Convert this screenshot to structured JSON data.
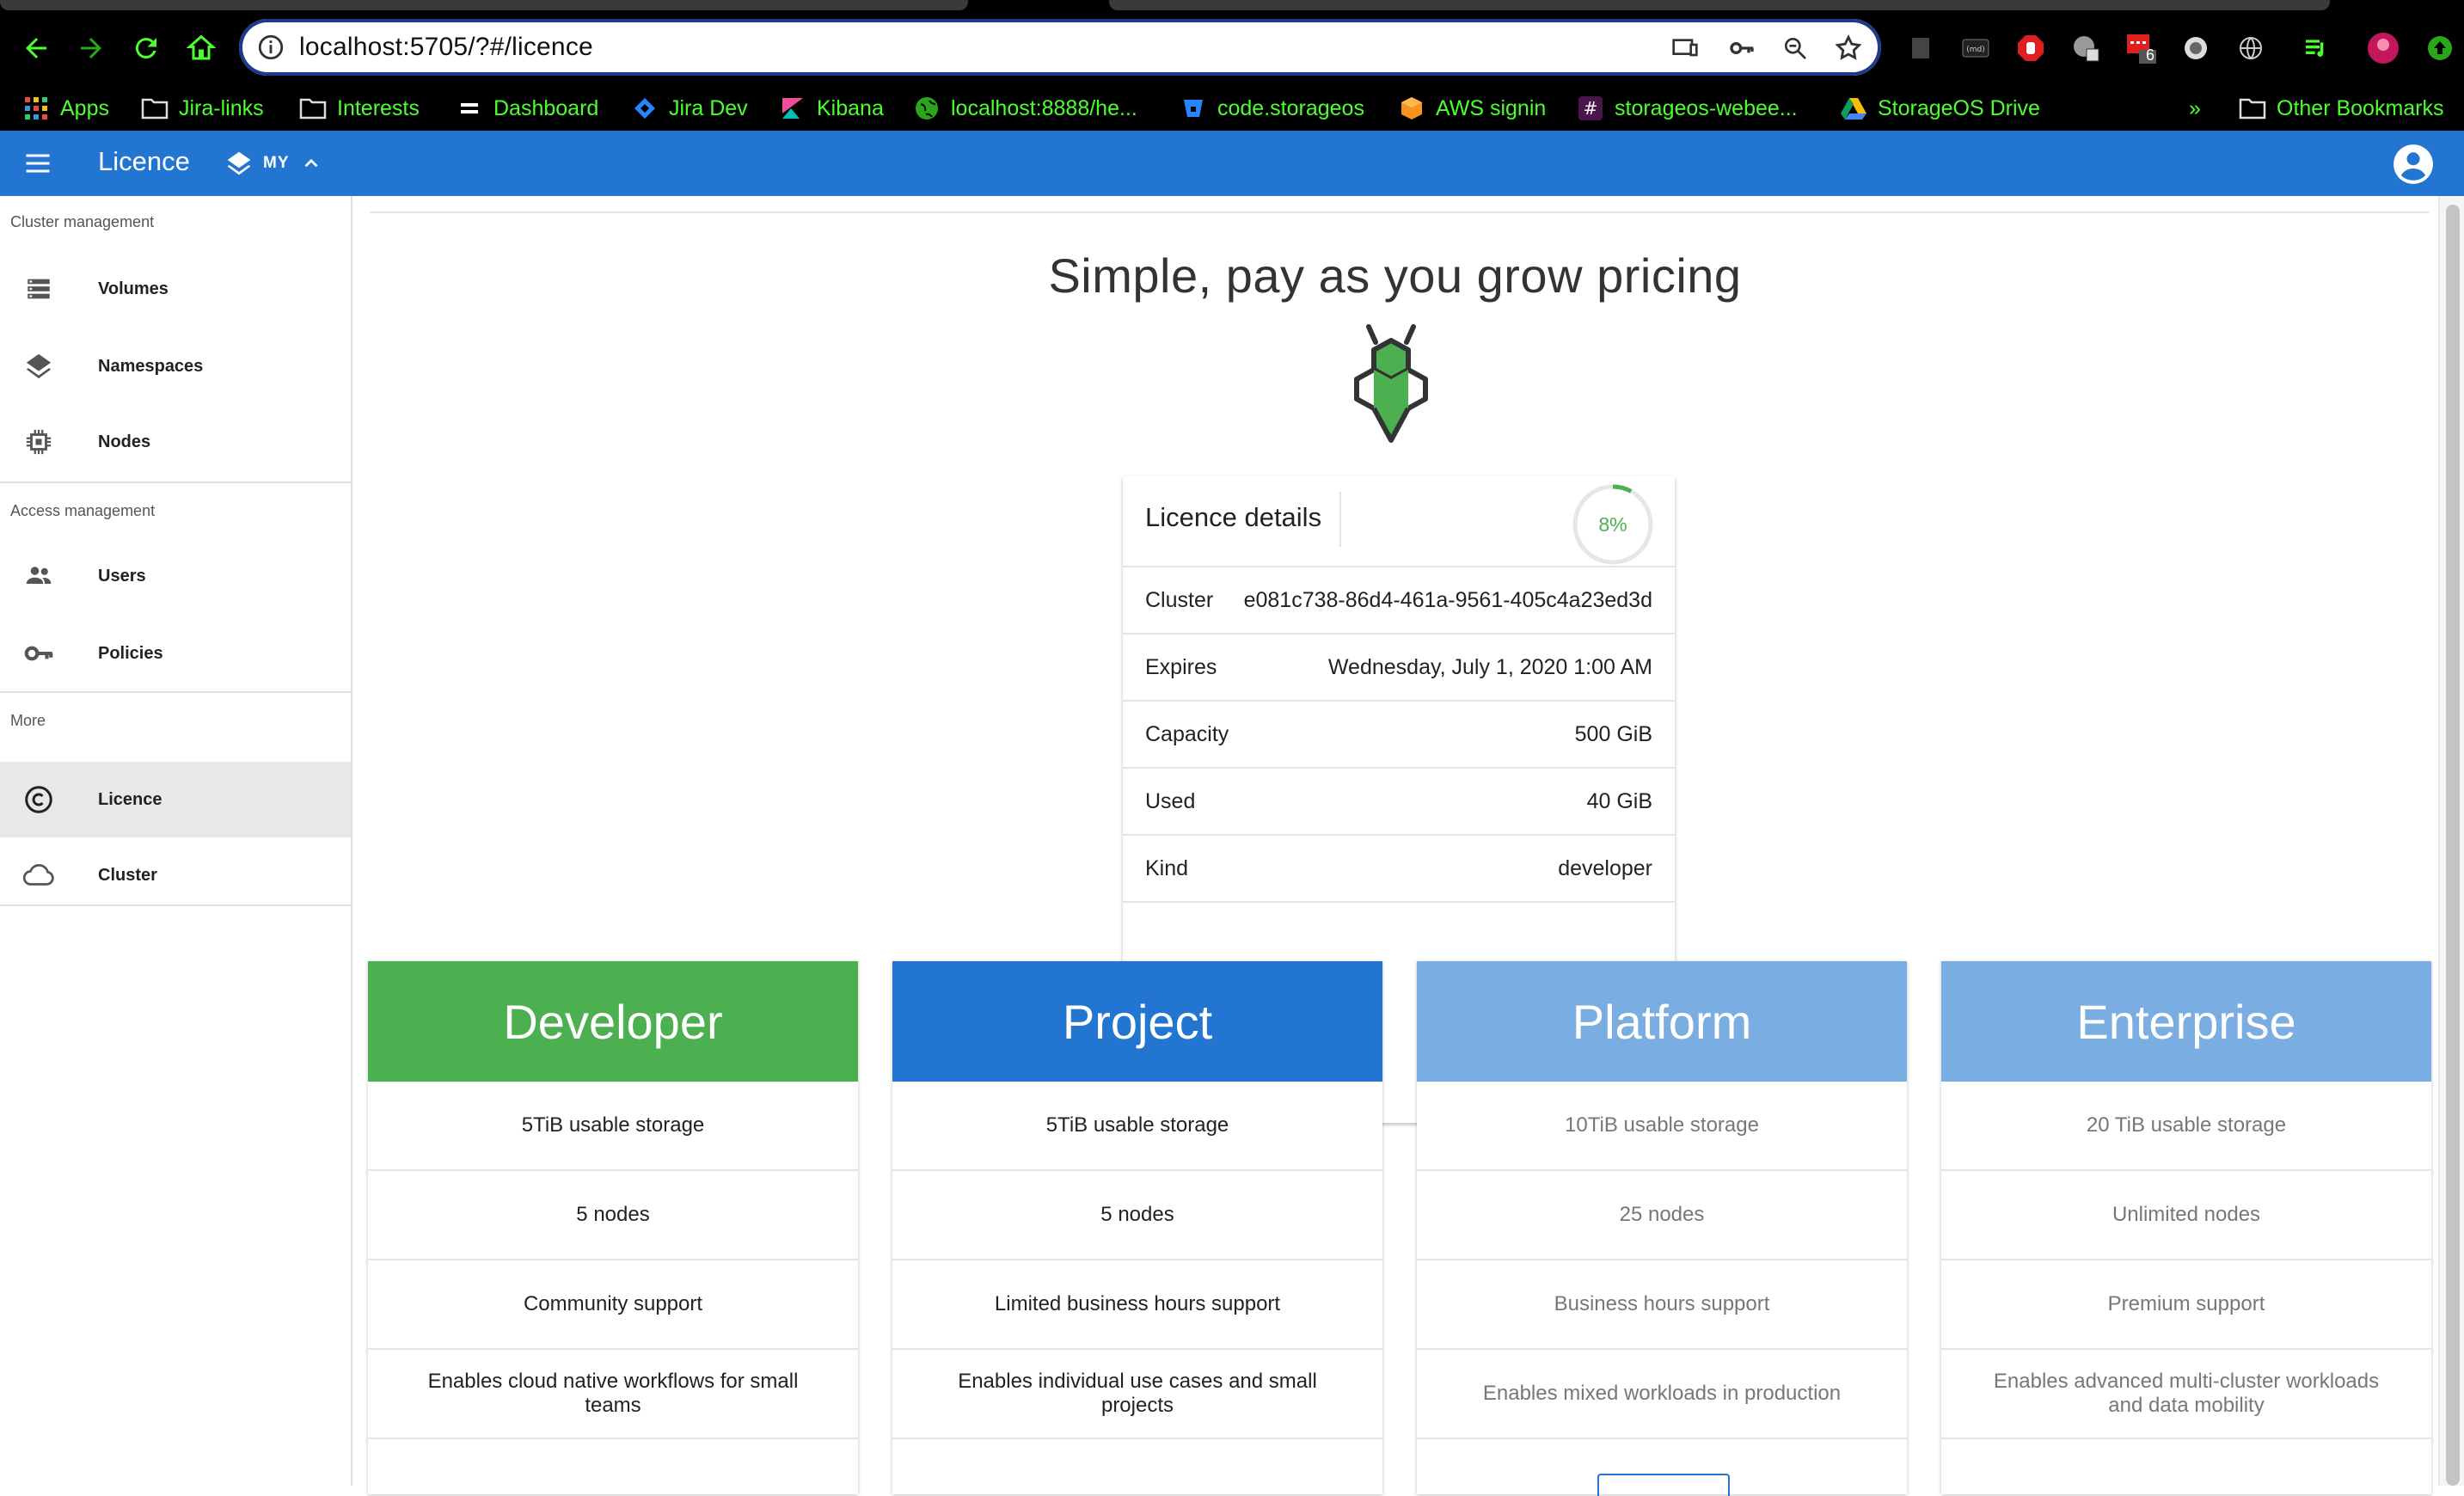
{
  "browser": {
    "url": "localhost:5705/?#/licence",
    "bookmarks": [
      {
        "label": "Apps",
        "icon": "apps-grid-icon"
      },
      {
        "label": "Jira-links",
        "icon": "folder-icon"
      },
      {
        "label": "Interests",
        "icon": "folder-icon"
      },
      {
        "label": "Dashboard",
        "icon": "dashboard-icon"
      },
      {
        "label": "Jira Dev",
        "icon": "jira-icon"
      },
      {
        "label": "Kibana",
        "icon": "kibana-icon"
      },
      {
        "label": "localhost:8888/he...",
        "icon": "globe-icon"
      },
      {
        "label": "code.storageos",
        "icon": "bitbucket-icon"
      },
      {
        "label": "AWS signin",
        "icon": "aws-icon"
      },
      {
        "label": "storageos-webee...",
        "icon": "slack-icon"
      },
      {
        "label": "StorageOS Drive",
        "icon": "drive-icon"
      }
    ],
    "more_bookmarks": "»",
    "other_bookmarks": "Other Bookmarks",
    "extension_badge": "6"
  },
  "appbar": {
    "title": "Licence",
    "namespace": "MY"
  },
  "sidebar": {
    "sections": [
      {
        "title": "Cluster management",
        "items": [
          {
            "label": "Volumes",
            "icon": "volumes-icon"
          },
          {
            "label": "Namespaces",
            "icon": "layers-icon"
          },
          {
            "label": "Nodes",
            "icon": "chip-icon"
          }
        ]
      },
      {
        "title": "Access management",
        "items": [
          {
            "label": "Users",
            "icon": "users-icon"
          },
          {
            "label": "Policies",
            "icon": "key-icon"
          }
        ]
      },
      {
        "title": "More",
        "items": [
          {
            "label": "Licence",
            "icon": "copyright-icon",
            "active": true
          },
          {
            "label": "Cluster",
            "icon": "cloud-icon"
          }
        ]
      }
    ]
  },
  "main": {
    "headline": "Simple, pay as you grow pricing",
    "licence": {
      "title": "Licence details",
      "usage_percent": 8,
      "usage_label": "8%",
      "rows": [
        {
          "key": "Cluster",
          "value": "e081c738-86d4-461a-9561-405c4a23ed3d"
        },
        {
          "key": "Expires",
          "value": "Wednesday, July 1, 2020 1:00 AM"
        },
        {
          "key": "Capacity",
          "value": "500 GiB"
        },
        {
          "key": "Used",
          "value": "40 GiB"
        },
        {
          "key": "Kind",
          "value": "developer"
        }
      ]
    },
    "plans": [
      {
        "name": "Developer",
        "color": "#4caf50",
        "muted": false,
        "features": [
          "5TiB usable storage",
          "5 nodes",
          "Community support",
          "Enables cloud native workflows for small teams"
        ]
      },
      {
        "name": "Project",
        "color": "#2276d2",
        "muted": false,
        "features": [
          "5TiB usable storage",
          "5 nodes",
          "Limited business hours support",
          "Enables individual use cases and small projects"
        ]
      },
      {
        "name": "Platform",
        "color": "#7aaee2",
        "muted": true,
        "features": [
          "10TiB usable storage",
          "25 nodes",
          "Business hours support",
          "Enables mixed workloads in production"
        ]
      },
      {
        "name": "Enterprise",
        "color": "#7aaee2",
        "muted": true,
        "features": [
          "20 TiB usable storage",
          "Unlimited nodes",
          "Premium support",
          "Enables advanced multi-cluster workloads and data mobility"
        ]
      }
    ]
  },
  "colors": {
    "appbar": "#2276d2",
    "bookmark_text": "#4cff2e",
    "gauge": "#4caf50"
  }
}
